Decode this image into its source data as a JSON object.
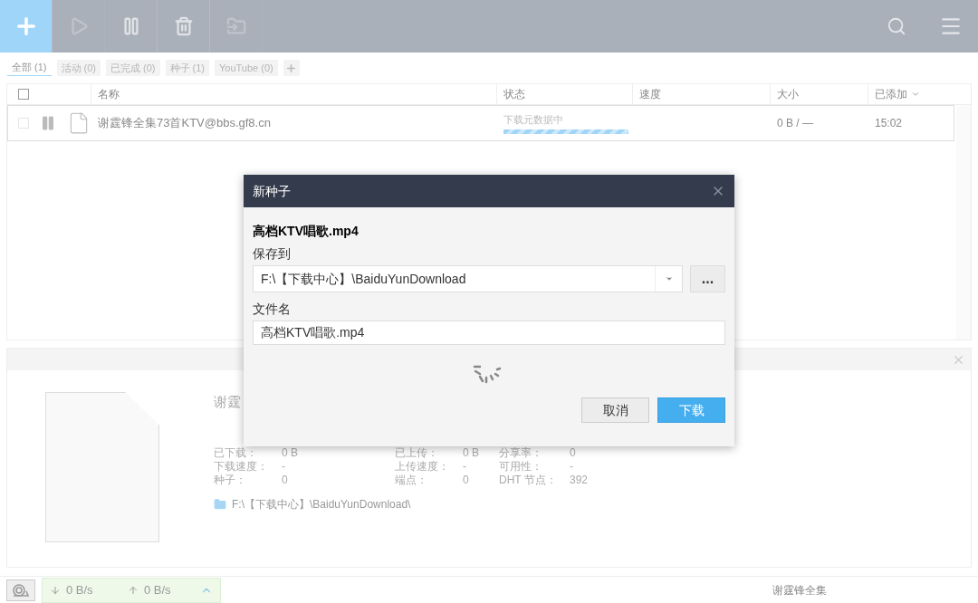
{
  "toolbar": {
    "buttons": [
      {
        "kind": "add",
        "disabled": false
      },
      {
        "kind": "start",
        "disabled": true
      },
      {
        "kind": "pause",
        "disabled": false
      },
      {
        "kind": "delete",
        "disabled": false
      },
      {
        "kind": "folder",
        "disabled": true
      }
    ]
  },
  "filter_tabs": [
    {
      "label": "全部 (1)",
      "selected": true
    },
    {
      "label": "活动 (0)",
      "selected": false
    },
    {
      "label": "已完成 (0)",
      "selected": false
    },
    {
      "label": "种子 (1)",
      "selected": false
    },
    {
      "label": "YouTube (0)",
      "selected": false
    }
  ],
  "table": {
    "select_all_checked": false,
    "columns": [
      "名称",
      "状态",
      "速度",
      "大小",
      "已添加"
    ],
    "rows": [
      {
        "checked": false,
        "name": "谢霆锋全集73首KTV@bbs.gf8.cn",
        "status": "下载元数据中",
        "level": 1,
        "size": "0 B / —",
        "added": "15:02"
      }
    ]
  },
  "details": {
    "title": "谢霆",
    "stats": [
      {
        "label": "已下载：",
        "value": "0 B"
      },
      {
        "label": "已上传：",
        "value": "0 B"
      },
      {
        "label": "分享率：",
        "value": "0"
      },
      {
        "label": "下载速度：",
        "value": "-"
      },
      {
        "label": "上传速度：",
        "value": "-"
      },
      {
        "label": "可用性：",
        "value": "-"
      },
      {
        "label": "种子：",
        "value": "0"
      },
      {
        "label": "端点：",
        "value": "0"
      },
      {
        "label": "DHT 节点：",
        "value": "392"
      }
    ],
    "path": "F:\\【下载中心】\\BaiduYunDownload\\"
  },
  "dialog": {
    "title": "新种子",
    "torrent_name": "高档KTV唱歌.mp4",
    "save_to_label": "保存到",
    "save_to_value": "F:\\【下载中心】\\BaiduYunDownload",
    "browse": "...",
    "filename_label": "文件名",
    "filename_value": "高档KTV唱歌.mp4",
    "cancel": "取消",
    "download": "下载"
  },
  "status_bar": {
    "download_speed": "0 B/s",
    "upload_speed": "0 B/s",
    "task_text": "谢霆锋全集"
  }
}
